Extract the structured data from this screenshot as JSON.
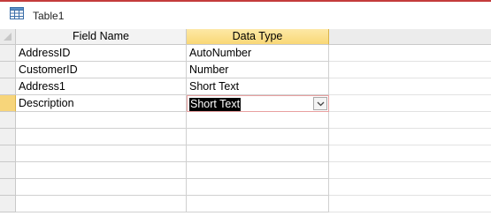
{
  "tab": {
    "title": "Table1",
    "icon": "table-icon"
  },
  "columns": {
    "field_name": "Field Name",
    "data_type": "Data Type"
  },
  "rows": [
    {
      "field_name": "AddressID",
      "data_type": "AutoNumber"
    },
    {
      "field_name": "CustomerID",
      "data_type": "Number"
    },
    {
      "field_name": "Address1",
      "data_type": "Short Text"
    },
    {
      "field_name": "Description",
      "data_type": "Short Text"
    }
  ],
  "current_row_index": 3,
  "empty_row_count": 7,
  "colors": {
    "accent_border": "#c43b3b",
    "selected_header": "#f9d876",
    "current_row_selector": "#f7d57a"
  }
}
